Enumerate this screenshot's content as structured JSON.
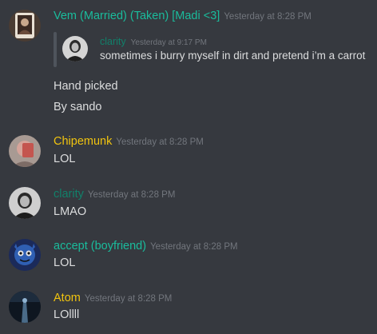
{
  "messages": [
    {
      "author": "Vem (Married) (Taken) [Madi <3]",
      "author_color": "#1abc9c",
      "timestamp": "Yesterday at 8:28 PM",
      "avatar_icon": "portrait-photo",
      "quote": {
        "author": "clarity",
        "author_color": "#11806a",
        "timestamp": "Yesterday at 9:17 PM",
        "text": "sometimes i burry myself in dirt and pretend i’m a carrot",
        "avatar_icon": "dark-portrait-photo"
      },
      "lines": [
        "Hand picked",
        "By sando"
      ]
    },
    {
      "author": "Chipemunk",
      "author_color": "#f1c40f",
      "timestamp": "Yesterday at 8:28 PM",
      "avatar_icon": "selfie-photo",
      "lines": [
        "LOL"
      ]
    },
    {
      "author": "clarity",
      "author_color": "#11806a",
      "timestamp": "Yesterday at 8:28 PM",
      "avatar_icon": "dark-portrait-photo",
      "lines": [
        "LMAO"
      ]
    },
    {
      "author": "accept (boyfriend)",
      "author_color": "#1abc9c",
      "timestamp": "Yesterday at 8:28 PM",
      "avatar_icon": "cartoon-avatar",
      "lines": [
        "LOL"
      ]
    },
    {
      "author": "Atom",
      "author_color": "#f1c40f",
      "timestamp": "Yesterday at 8:28 PM",
      "avatar_icon": "night-photo",
      "lines": [
        "LOllll"
      ]
    }
  ]
}
